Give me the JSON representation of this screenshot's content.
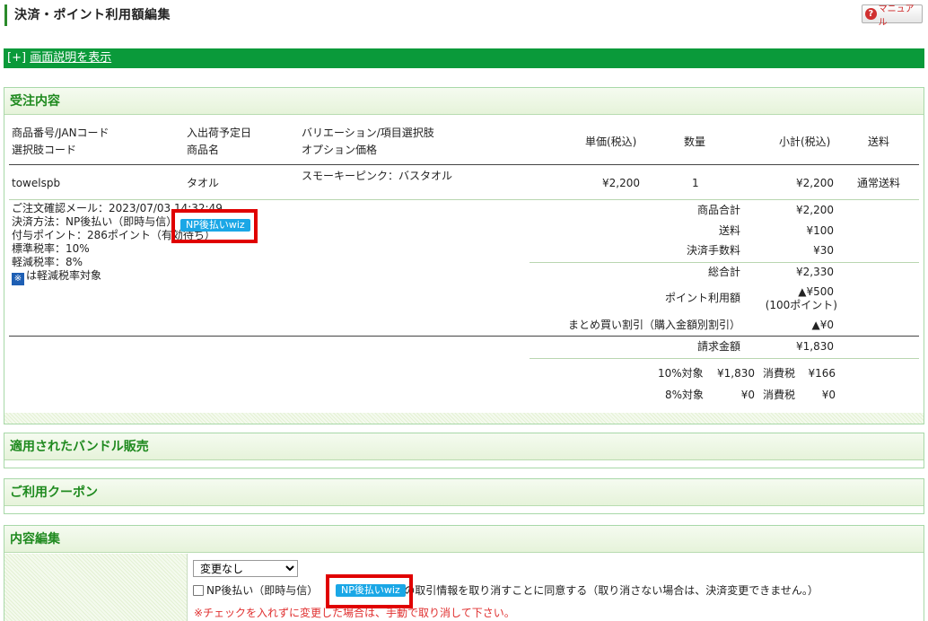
{
  "header": {
    "title": "決済・ポイント利用額編集",
    "manual_label": "マニュアル",
    "help_bracket": "[+]",
    "help_link": "画面説明を表示"
  },
  "order": {
    "heading": "受注内容",
    "columns": {
      "col1_line1": "商品番号/JANコード",
      "col1_line2": "選択肢コード",
      "col2_line1": "入出荷予定日",
      "col2_line2": "商品名",
      "col3_line1": "バリエーション/項目選択肢",
      "col3_line2": "オプション価格",
      "unit_price": "単価(税込)",
      "quantity": "数量",
      "subtotal": "小計(税込)",
      "shipping": "送料"
    },
    "item": {
      "code": "towelspb",
      "name": "タオル",
      "variation": "スモーキーピンク：バスタオル",
      "unit_price": "¥2,200",
      "quantity": "1",
      "subtotal": "¥2,200",
      "shipping": "通常送料"
    },
    "info": {
      "confirm_mail": "ご注文確認メール：2023/07/03 14:32:49",
      "payment_method": "決済方法：NP後払い（即時与信）",
      "np_badge": "NP後払いwiz",
      "points": "付与ポイント：286ポイント（有効待ち）",
      "standard_tax": "標準税率：10%",
      "reduced_tax": "軽減税率：8%",
      "reduced_icon": "※",
      "reduced_note": "は軽減税率対象"
    },
    "summary": [
      {
        "label": "商品合計",
        "value": "¥2,200"
      },
      {
        "label": "送料",
        "value": "¥100"
      },
      {
        "label": "決済手数料",
        "value": "¥30"
      },
      {
        "label": "総合計",
        "value": "¥2,330"
      },
      {
        "label": "ポイント利用額",
        "value": "▲¥500",
        "sub": "(100ポイント)"
      },
      {
        "label": "まとめ買い割引（購入金額別割引）",
        "value": "▲¥0"
      },
      {
        "label": "請求金額",
        "value": "¥1,830"
      }
    ],
    "tax": {
      "row10_label": "10%対象",
      "row10_amount": "¥1,830",
      "row10_tax_label": "消費税",
      "row10_tax": "¥166",
      "row8_label": "8%対象",
      "row8_amount": "¥0",
      "row8_tax_label": "消費税",
      "row8_tax": "¥0"
    }
  },
  "bundle": {
    "heading": "適用されたバンドル販売"
  },
  "coupon": {
    "heading": "ご利用クーポン"
  },
  "edit": {
    "heading": "内容編集",
    "select_value": "変更なし",
    "select_options": [
      "変更なし"
    ],
    "checkbox_prefix": "NP後払い（即時与信）",
    "np_badge": "NP後払いwiz",
    "checkbox_suffix": "の取引情報を取り消すことに同意する（取り消さない場合は、決済変更できません。）",
    "warning": "※チェックを入れずに変更した場合は、手動で取り消して下さい。"
  },
  "colors": {
    "accent_green": "#0a9a3a",
    "heading_green": "#1f8a1f",
    "np_blue": "#1aa7e6",
    "highlight_red": "#e00000",
    "warning_red": "#e03030"
  },
  "icons": {
    "manual": "question-circle-icon",
    "reduced_tax": "reduced-tax-mark-icon"
  }
}
